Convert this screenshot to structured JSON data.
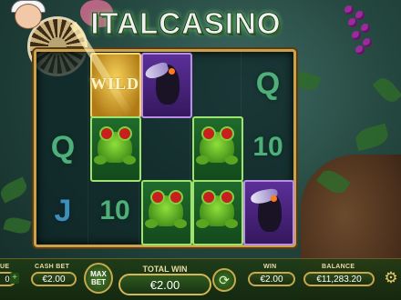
{
  "app": {
    "brand_logo": "ITALCASINO"
  },
  "reels": {
    "columns": [
      [
        "Q",
        "J"
      ],
      [
        "WILD",
        "frog",
        "10"
      ],
      [
        "toucan",
        "frog"
      ],
      [
        "frog",
        "frog"
      ],
      [
        "Q",
        "10",
        "toucan"
      ]
    ],
    "symbols": {
      "q": "Q",
      "j": "J",
      "ten": "10",
      "wild": "WILD"
    }
  },
  "controls": {
    "left_value": "0",
    "left_label": "UE",
    "cashbet_label": "CASH BET",
    "cashbet_value": "€2.00",
    "maxbet_label_1": "MAX",
    "maxbet_label_2": "BET",
    "total_win_label": "TOTAL WIN",
    "total_win_value": "€2.00",
    "win_label": "WIN",
    "win_value": "€2.00",
    "balance_label": "BALANCE",
    "balance_value": "€11,283.20"
  },
  "icons": {
    "autoplay": "refresh-arrow-icon",
    "settings": "gear-icon",
    "plus": "plus-icon"
  },
  "colors": {
    "frame_gold": "#c9a24a",
    "highlight_green": "#9ee36e",
    "highlight_purple": "#b98ee6",
    "highlight_gold": "#f3d66c"
  }
}
